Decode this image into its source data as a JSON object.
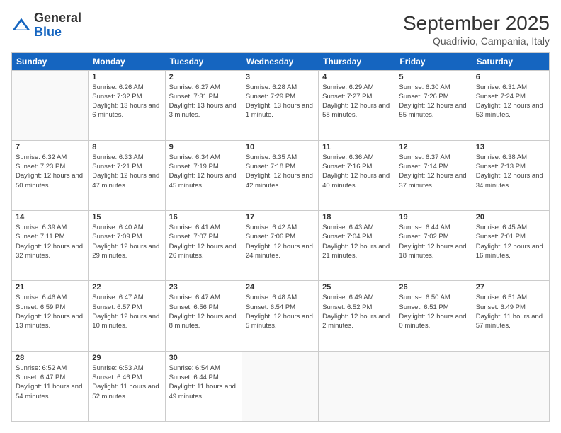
{
  "header": {
    "logo_general": "General",
    "logo_blue": "Blue",
    "month_title": "September 2025",
    "location": "Quadrivio, Campania, Italy"
  },
  "calendar": {
    "days_of_week": [
      "Sunday",
      "Monday",
      "Tuesday",
      "Wednesday",
      "Thursday",
      "Friday",
      "Saturday"
    ],
    "weeks": [
      [
        {
          "day": "",
          "empty": true
        },
        {
          "day": "1",
          "sunrise": "6:26 AM",
          "sunset": "7:32 PM",
          "daylight": "13 hours and 6 minutes."
        },
        {
          "day": "2",
          "sunrise": "6:27 AM",
          "sunset": "7:31 PM",
          "daylight": "13 hours and 3 minutes."
        },
        {
          "day": "3",
          "sunrise": "6:28 AM",
          "sunset": "7:29 PM",
          "daylight": "13 hours and 1 minute."
        },
        {
          "day": "4",
          "sunrise": "6:29 AM",
          "sunset": "7:27 PM",
          "daylight": "12 hours and 58 minutes."
        },
        {
          "day": "5",
          "sunrise": "6:30 AM",
          "sunset": "7:26 PM",
          "daylight": "12 hours and 55 minutes."
        },
        {
          "day": "6",
          "sunrise": "6:31 AM",
          "sunset": "7:24 PM",
          "daylight": "12 hours and 53 minutes."
        }
      ],
      [
        {
          "day": "7",
          "sunrise": "6:32 AM",
          "sunset": "7:23 PM",
          "daylight": "12 hours and 50 minutes."
        },
        {
          "day": "8",
          "sunrise": "6:33 AM",
          "sunset": "7:21 PM",
          "daylight": "12 hours and 47 minutes."
        },
        {
          "day": "9",
          "sunrise": "6:34 AM",
          "sunset": "7:19 PM",
          "daylight": "12 hours and 45 minutes."
        },
        {
          "day": "10",
          "sunrise": "6:35 AM",
          "sunset": "7:18 PM",
          "daylight": "12 hours and 42 minutes."
        },
        {
          "day": "11",
          "sunrise": "6:36 AM",
          "sunset": "7:16 PM",
          "daylight": "12 hours and 40 minutes."
        },
        {
          "day": "12",
          "sunrise": "6:37 AM",
          "sunset": "7:14 PM",
          "daylight": "12 hours and 37 minutes."
        },
        {
          "day": "13",
          "sunrise": "6:38 AM",
          "sunset": "7:13 PM",
          "daylight": "12 hours and 34 minutes."
        }
      ],
      [
        {
          "day": "14",
          "sunrise": "6:39 AM",
          "sunset": "7:11 PM",
          "daylight": "12 hours and 32 minutes."
        },
        {
          "day": "15",
          "sunrise": "6:40 AM",
          "sunset": "7:09 PM",
          "daylight": "12 hours and 29 minutes."
        },
        {
          "day": "16",
          "sunrise": "6:41 AM",
          "sunset": "7:07 PM",
          "daylight": "12 hours and 26 minutes."
        },
        {
          "day": "17",
          "sunrise": "6:42 AM",
          "sunset": "7:06 PM",
          "daylight": "12 hours and 24 minutes."
        },
        {
          "day": "18",
          "sunrise": "6:43 AM",
          "sunset": "7:04 PM",
          "daylight": "12 hours and 21 minutes."
        },
        {
          "day": "19",
          "sunrise": "6:44 AM",
          "sunset": "7:02 PM",
          "daylight": "12 hours and 18 minutes."
        },
        {
          "day": "20",
          "sunrise": "6:45 AM",
          "sunset": "7:01 PM",
          "daylight": "12 hours and 16 minutes."
        }
      ],
      [
        {
          "day": "21",
          "sunrise": "6:46 AM",
          "sunset": "6:59 PM",
          "daylight": "12 hours and 13 minutes."
        },
        {
          "day": "22",
          "sunrise": "6:47 AM",
          "sunset": "6:57 PM",
          "daylight": "12 hours and 10 minutes."
        },
        {
          "day": "23",
          "sunrise": "6:47 AM",
          "sunset": "6:56 PM",
          "daylight": "12 hours and 8 minutes."
        },
        {
          "day": "24",
          "sunrise": "6:48 AM",
          "sunset": "6:54 PM",
          "daylight": "12 hours and 5 minutes."
        },
        {
          "day": "25",
          "sunrise": "6:49 AM",
          "sunset": "6:52 PM",
          "daylight": "12 hours and 2 minutes."
        },
        {
          "day": "26",
          "sunrise": "6:50 AM",
          "sunset": "6:51 PM",
          "daylight": "12 hours and 0 minutes."
        },
        {
          "day": "27",
          "sunrise": "6:51 AM",
          "sunset": "6:49 PM",
          "daylight": "11 hours and 57 minutes."
        }
      ],
      [
        {
          "day": "28",
          "sunrise": "6:52 AM",
          "sunset": "6:47 PM",
          "daylight": "11 hours and 54 minutes."
        },
        {
          "day": "29",
          "sunrise": "6:53 AM",
          "sunset": "6:46 PM",
          "daylight": "11 hours and 52 minutes."
        },
        {
          "day": "30",
          "sunrise": "6:54 AM",
          "sunset": "6:44 PM",
          "daylight": "11 hours and 49 minutes."
        },
        {
          "day": "",
          "empty": true
        },
        {
          "day": "",
          "empty": true
        },
        {
          "day": "",
          "empty": true
        },
        {
          "day": "",
          "empty": true
        }
      ]
    ]
  }
}
